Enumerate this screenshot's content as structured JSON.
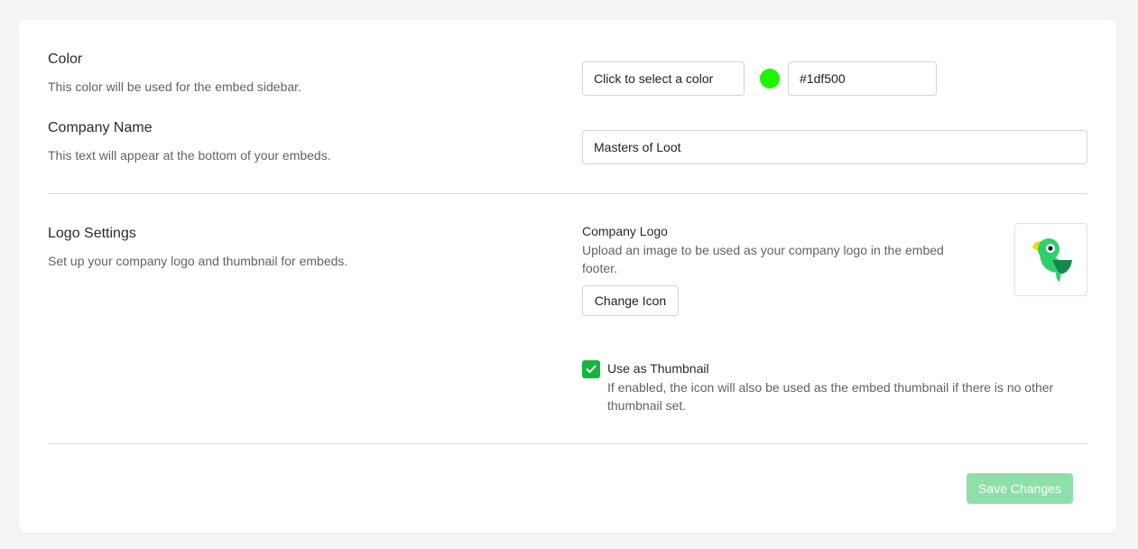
{
  "color_section": {
    "title": "Color",
    "description": "This color will be used for the embed sidebar.",
    "picker_label": "Click to select a color",
    "swatch_color": "#1df500",
    "hex_value": "#1df500"
  },
  "company_section": {
    "title": "Company Name",
    "description": "This text will appear at the bottom of your embeds.",
    "name_value": "Masters of Loot"
  },
  "logo_section": {
    "title": "Logo Settings",
    "description": "Set up your company logo and thumbnail for embeds.",
    "logo_label": "Company Logo",
    "logo_description": "Upload an image to be used as your company logo in the embed footer.",
    "change_icon_label": "Change Icon",
    "logo_icon": "parrot-logo-icon",
    "thumbnail_label": "Use as Thumbnail",
    "thumbnail_description": "If enabled, the icon will also be used as the embed thumbnail if there is no other thumbnail set.",
    "thumbnail_checked": true
  },
  "footer": {
    "save_label": "Save Changes",
    "save_color": "#8ee0a8"
  },
  "colors": {
    "accent_green": "#14b53c"
  }
}
